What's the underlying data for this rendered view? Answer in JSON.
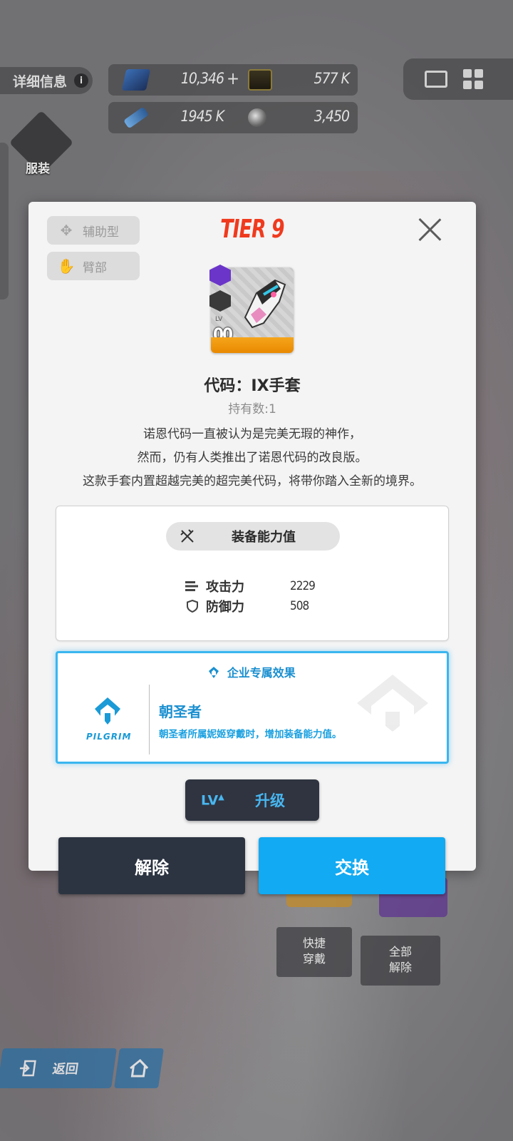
{
  "background": {
    "detail_label": "详细信息",
    "info_icon": "info-icon",
    "resources": [
      {
        "icon": "crystal-icon",
        "value": "10,346"
      },
      {
        "icon": "gold-icon",
        "value": "577 K"
      },
      {
        "icon": "battery-icon",
        "value": "1945 K"
      },
      {
        "icon": "orb-icon",
        "value": "3,450"
      }
    ],
    "costume_label": "服装",
    "quick_equip_label": "快捷\n穿戴",
    "unequip_all_label": "全部\n解除",
    "back_label": "返回"
  },
  "modal": {
    "tags": {
      "role": "辅助型",
      "part": "臂部"
    },
    "tier": "TIER 9",
    "item": {
      "level_label": "LV",
      "level": "00",
      "name": "代码：IX手套",
      "owned": "持有数:1",
      "description_lines": [
        "诺恩代码一直被认为是完美无瑕的神作，",
        "然而，仍有人类推出了诺恩代码的改良版。",
        "这款手套内置超越完美的超完美代码，将带你踏入全新的境界。"
      ]
    },
    "stats": {
      "header": "装备能力值",
      "rows": [
        {
          "label": "攻击力",
          "value": "2229"
        },
        {
          "label": "防御力",
          "value": "508"
        }
      ]
    },
    "corp_effect": {
      "title": "企业专属效果",
      "logo_text": "PILGRIM",
      "name": "朝圣者",
      "description": "朝圣者所属妮姬穿戴时，增加装备能力值。"
    },
    "upgrade": {
      "lv": "LV",
      "label": "升级"
    },
    "buttons": {
      "unequip": "解除",
      "swap": "交换"
    }
  },
  "colors": {
    "tier": "#f03a1e",
    "accent_blue": "#12aaf2",
    "corp_blue": "#1a8fd0",
    "dark_button": "#2c3441",
    "rarity_orange": "#e98900"
  }
}
